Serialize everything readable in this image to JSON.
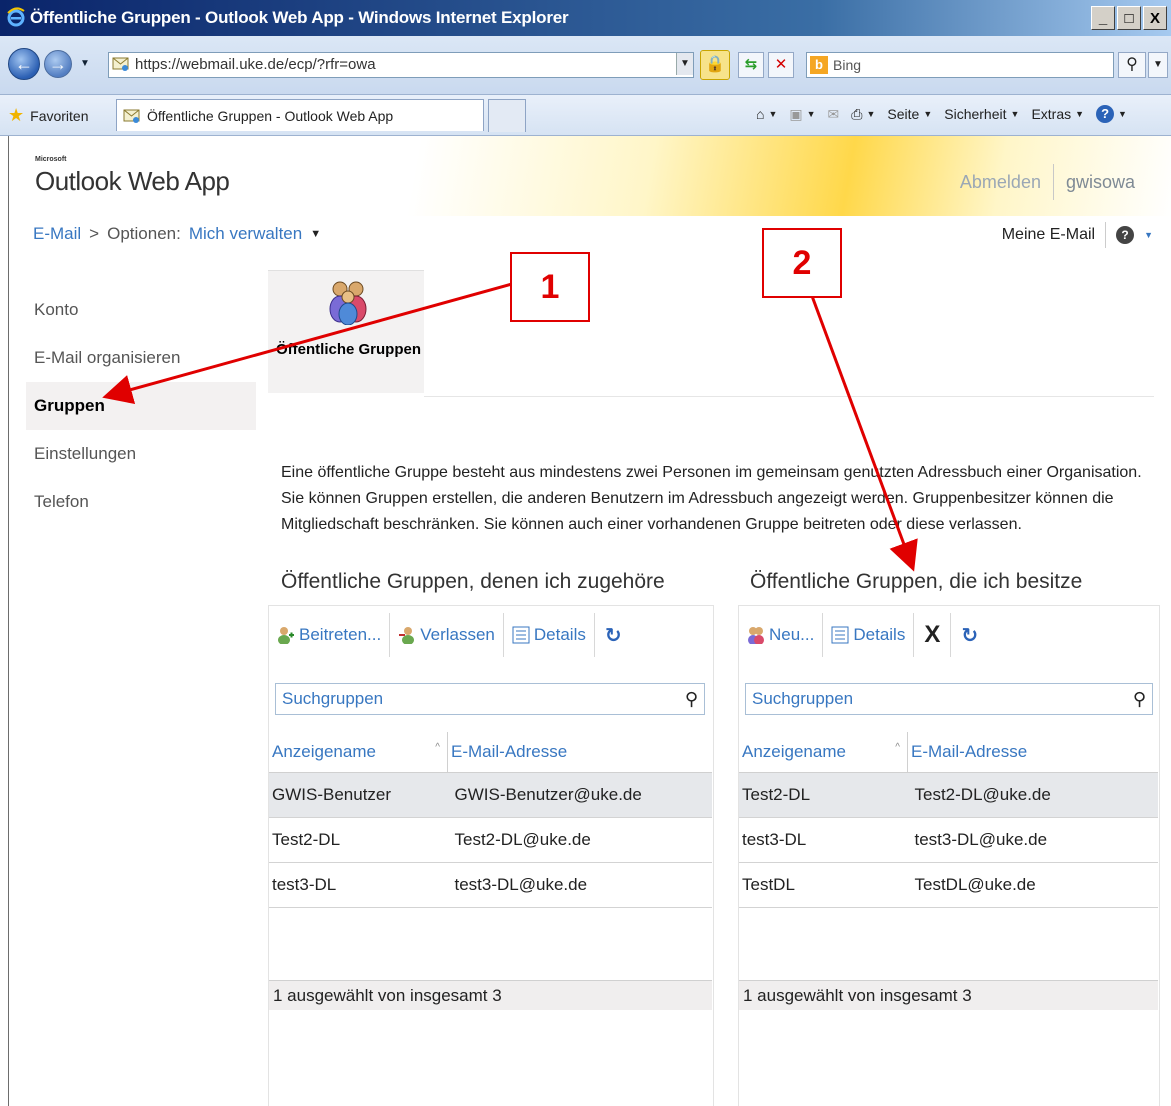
{
  "browser": {
    "title": "Öffentliche Gruppen - Outlook Web App - Windows Internet Explorer",
    "url": "https://webmail.uke.de/ecp/?rfr=owa",
    "search_engine": "Bing",
    "favorites_label": "Favoriten",
    "tab_title": "Öffentliche Gruppen - Outlook Web App",
    "commands": {
      "page": "Seite",
      "safety": "Sicherheit",
      "tools": "Extras"
    },
    "window_buttons": {
      "minimize": "_",
      "maximize": "□",
      "close": "X"
    }
  },
  "owa": {
    "brand_small": "Microsoft",
    "brand": "Outlook Web App",
    "sign_out": "Abmelden",
    "user": "gwisowa",
    "breadcrumb": {
      "mail": "E-Mail",
      "separator": ">",
      "options": "Optionen:",
      "scope": "Mich verwalten"
    },
    "my_mail": "Meine E-Mail",
    "nav": [
      "Konto",
      "E-Mail organisieren",
      "Gruppen",
      "Einstellungen",
      "Telefon"
    ],
    "nav_selected": "Gruppen",
    "tile_label": "Öffentliche Gruppen",
    "description": "Eine öffentliche Gruppe besteht aus mindestens zwei Personen im gemeinsam genutzten Adressbuch einer Organisation. Sie können Gruppen erstellen, die anderen Benutzern im Adressbuch angezeigt werden. Gruppenbesitzer können die Mitgliedschaft beschränken. Sie können auch einer vorhandenen Gruppe beitreten oder diese verlassen."
  },
  "member_groups": {
    "title": "Öffentliche Gruppen, denen ich zugehöre",
    "toolbar": {
      "join": "Beitreten...",
      "leave": "Verlassen",
      "details": "Details"
    },
    "search_placeholder": "Suchgruppen",
    "columns": [
      "Anzeigename",
      "E-Mail-Adresse"
    ],
    "rows": [
      {
        "name": "GWIS-Benutzer",
        "email": "GWIS-Benutzer@uke.de",
        "selected": true
      },
      {
        "name": "Test2-DL",
        "email": "Test2-DL@uke.de",
        "selected": false
      },
      {
        "name": "test3-DL",
        "email": "test3-DL@uke.de",
        "selected": false
      }
    ],
    "status": "1 ausgewählt von insgesamt 3"
  },
  "owned_groups": {
    "title": "Öffentliche Gruppen, die ich besitze",
    "toolbar": {
      "new": "Neu...",
      "details": "Details",
      "delete": "X"
    },
    "search_placeholder": "Suchgruppen",
    "columns": [
      "Anzeigename",
      "E-Mail-Adresse"
    ],
    "rows": [
      {
        "name": "Test2-DL",
        "email": "Test2-DL@uke.de",
        "selected": true
      },
      {
        "name": "test3-DL",
        "email": "test3-DL@uke.de",
        "selected": false
      },
      {
        "name": "TestDL",
        "email": "TestDL@uke.de",
        "selected": false
      }
    ],
    "status": "1 ausgewählt von insgesamt 3"
  },
  "annotations": {
    "one": "1",
    "two": "2",
    "color": "#e00000"
  },
  "colors": {
    "link": "#3877c1",
    "selected_row": "#e6e8eb",
    "header_gold": "#ffd84a"
  }
}
